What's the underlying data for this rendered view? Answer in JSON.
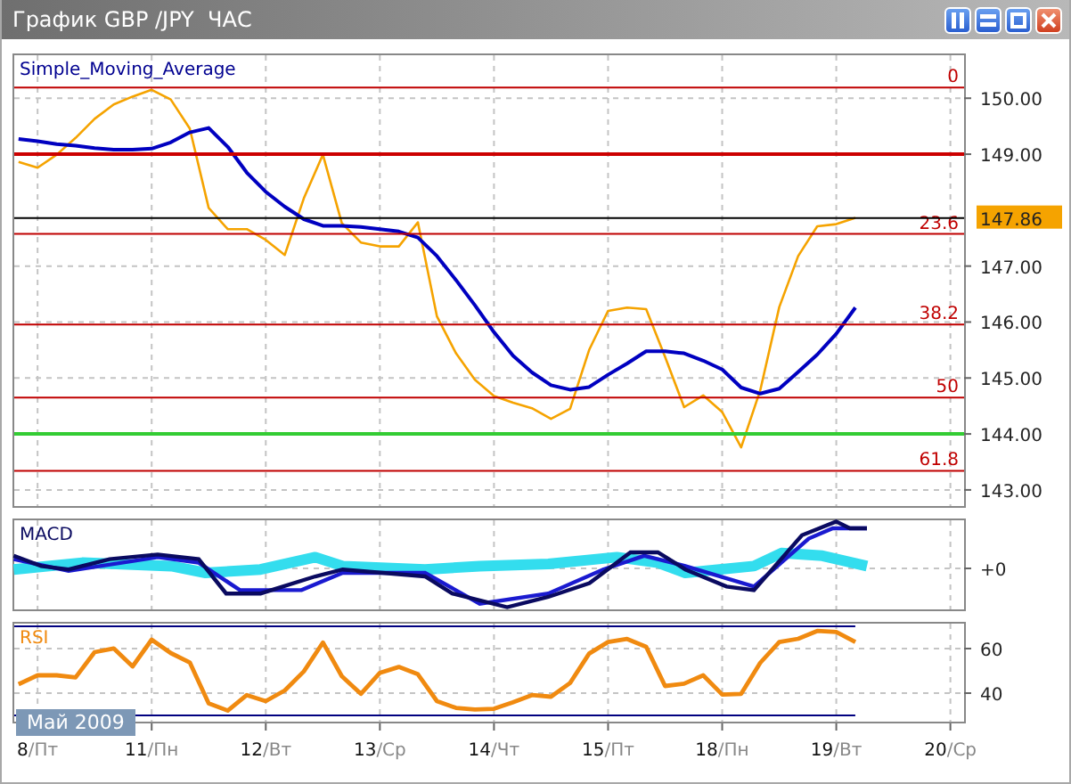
{
  "window": {
    "title": "График GBP /JPY  ЧАС"
  },
  "window_buttons": [
    {
      "kind": "tile"
    },
    {
      "kind": "minimize"
    },
    {
      "kind": "maximize"
    },
    {
      "kind": "close"
    }
  ],
  "price_panel": {
    "indicator_label": "Simple_Moving_Average",
    "chart_data": {
      "type": "line",
      "grid": true,
      "categories": [
        null,
        null,
        null,
        null,
        null,
        null,
        null,
        null,
        null,
        null,
        null,
        null,
        null,
        null,
        null,
        null,
        null,
        null,
        null,
        null,
        null,
        null,
        null,
        null,
        null,
        null,
        null,
        null,
        null,
        null,
        null,
        null,
        null,
        null,
        null,
        null,
        null,
        null,
        null,
        null,
        null,
        null,
        null,
        null,
        null,
        null,
        null,
        null,
        null,
        null
      ],
      "series": [
        {
          "color": "#f5a300",
          "values": [
            148.86,
            148.76,
            148.99,
            149.29,
            149.63,
            149.89,
            150.03,
            150.15,
            149.98,
            149.46,
            148.04,
            147.66,
            147.66,
            147.47,
            147.2,
            148.21,
            148.99,
            147.77,
            147.42,
            147.35,
            147.35,
            147.78,
            146.1,
            145.44,
            144.97,
            144.68,
            144.56,
            144.46,
            144.27,
            144.45,
            145.5,
            146.2,
            146.26,
            146.23,
            145.38,
            144.48,
            144.69,
            144.39,
            143.76,
            144.78,
            146.27,
            147.18,
            147.71,
            147.75,
            147.86,
            null,
            null,
            null,
            null,
            null
          ]
        },
        {
          "color": "#0000c0",
          "values": [
            149.27,
            149.23,
            149.18,
            149.15,
            149.11,
            149.08,
            149.08,
            149.1,
            149.21,
            149.39,
            149.47,
            149.13,
            148.67,
            148.33,
            148.06,
            147.84,
            147.72,
            147.72,
            147.7,
            147.66,
            147.62,
            147.51,
            147.18,
            146.75,
            146.3,
            145.82,
            145.4,
            145.1,
            144.87,
            144.79,
            144.84,
            145.06,
            145.26,
            145.48,
            145.48,
            145.44,
            145.31,
            145.15,
            144.83,
            144.72,
            144.81,
            145.11,
            145.42,
            145.79,
            146.26,
            null,
            null,
            null,
            null,
            null
          ]
        }
      ],
      "ylim": [
        142.68,
        150.8
      ],
      "yticks": [
        {
          "value": 143,
          "label": "143.00"
        },
        {
          "value": 144,
          "label": "144.00"
        },
        {
          "value": 145,
          "label": "145.00"
        },
        {
          "value": 146,
          "label": "146.00"
        },
        {
          "value": 147,
          "label": "147.00"
        },
        {
          "value": 149,
          "label": "149.00"
        },
        {
          "value": 150,
          "label": "150.00"
        }
      ]
    },
    "fibonacci_labels": [
      "0",
      "23.6",
      "38.2",
      "50",
      "61.8"
    ],
    "current_price": "147.86"
  },
  "macd_panel": {
    "label": "MACD",
    "zero_label": "+0"
  },
  "rsi_panel": {
    "label": "RSI",
    "period_badge": "Май 2009",
    "chart_data": {
      "type": "line",
      "grid": true,
      "categories": [
        null,
        "8/Пт",
        null,
        null,
        null,
        null,
        null,
        "11/Пн",
        null,
        null,
        null,
        null,
        null,
        "12/Вт",
        null,
        null,
        null,
        null,
        null,
        "13/Ср",
        null,
        null,
        null,
        null,
        null,
        "14/Чт",
        null,
        null,
        null,
        null,
        null,
        "15/Пт",
        null,
        null,
        null,
        null,
        null,
        "18/Пн",
        null,
        null,
        null,
        null,
        null,
        "19/Вт",
        null,
        null,
        null,
        null,
        null,
        "20/Ср"
      ],
      "series": [
        {
          "color": "#f08a10",
          "values": [
            44,
            48,
            48,
            47,
            58.4,
            60.1,
            52,
            64,
            58,
            53.8,
            35.4,
            32.2,
            39.1,
            36.4,
            41.2,
            49.8,
            62.7,
            47.6,
            39.7,
            49.1,
            51.8,
            48.5,
            36.4,
            33.4,
            32.6,
            33,
            35.9,
            39.1,
            38.4,
            44.6,
            57.8,
            63,
            64.3,
            60.8,
            43.2,
            44.2,
            48,
            39.4,
            39.7,
            53.6,
            63,
            64.4,
            67.9,
            67.4,
            63,
            null,
            null,
            null,
            null,
            null
          ]
        }
      ],
      "ylim": [
        26.4,
        72
      ],
      "yticks": [
        {
          "value": 40,
          "label": "40"
        },
        {
          "value": 60,
          "label": "60"
        }
      ]
    }
  }
}
